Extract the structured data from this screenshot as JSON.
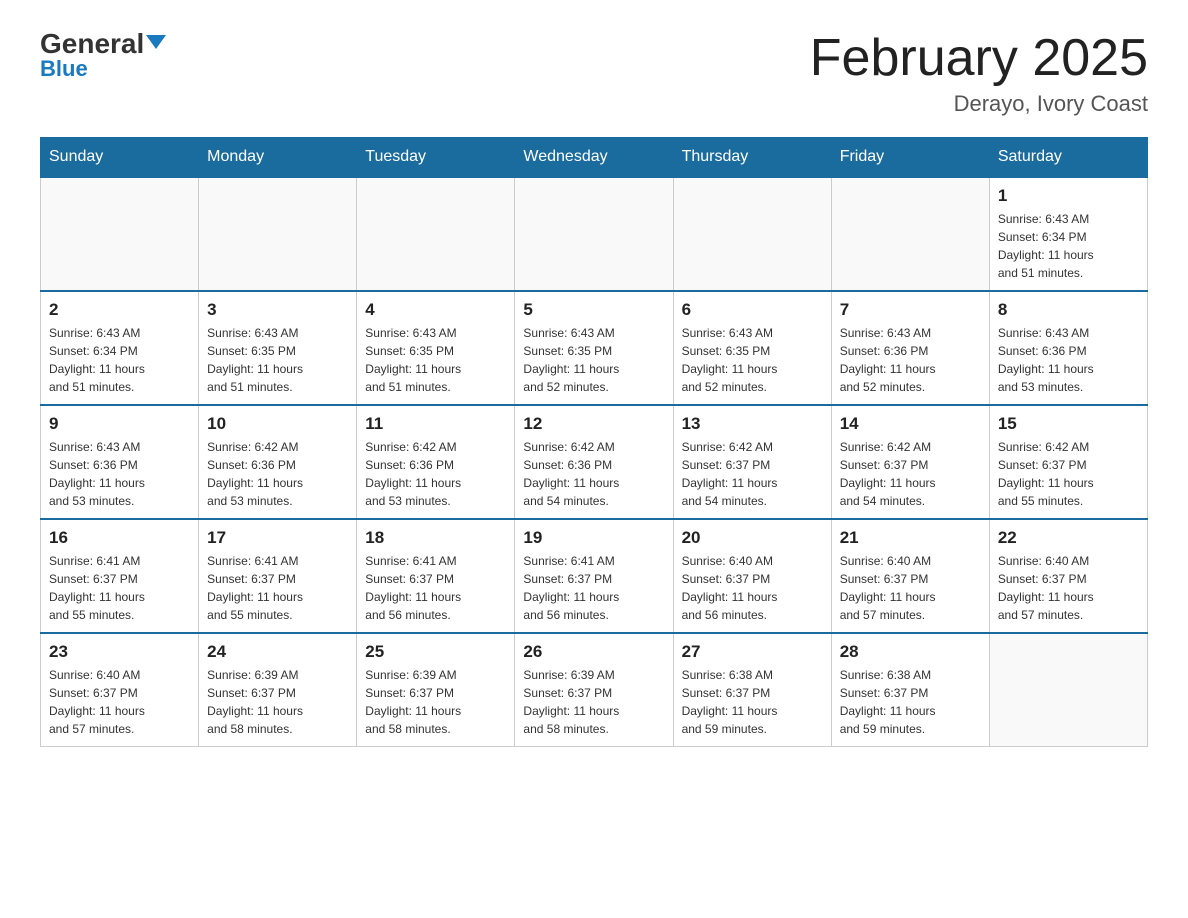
{
  "header": {
    "logo_general": "General",
    "logo_blue": "Blue",
    "title": "February 2025",
    "subtitle": "Derayo, Ivory Coast"
  },
  "days_of_week": [
    "Sunday",
    "Monday",
    "Tuesday",
    "Wednesday",
    "Thursday",
    "Friday",
    "Saturday"
  ],
  "weeks": [
    {
      "days": [
        {
          "number": "",
          "info": ""
        },
        {
          "number": "",
          "info": ""
        },
        {
          "number": "",
          "info": ""
        },
        {
          "number": "",
          "info": ""
        },
        {
          "number": "",
          "info": ""
        },
        {
          "number": "",
          "info": ""
        },
        {
          "number": "1",
          "info": "Sunrise: 6:43 AM\nSunset: 6:34 PM\nDaylight: 11 hours\nand 51 minutes."
        }
      ]
    },
    {
      "days": [
        {
          "number": "2",
          "info": "Sunrise: 6:43 AM\nSunset: 6:34 PM\nDaylight: 11 hours\nand 51 minutes."
        },
        {
          "number": "3",
          "info": "Sunrise: 6:43 AM\nSunset: 6:35 PM\nDaylight: 11 hours\nand 51 minutes."
        },
        {
          "number": "4",
          "info": "Sunrise: 6:43 AM\nSunset: 6:35 PM\nDaylight: 11 hours\nand 51 minutes."
        },
        {
          "number": "5",
          "info": "Sunrise: 6:43 AM\nSunset: 6:35 PM\nDaylight: 11 hours\nand 52 minutes."
        },
        {
          "number": "6",
          "info": "Sunrise: 6:43 AM\nSunset: 6:35 PM\nDaylight: 11 hours\nand 52 minutes."
        },
        {
          "number": "7",
          "info": "Sunrise: 6:43 AM\nSunset: 6:36 PM\nDaylight: 11 hours\nand 52 minutes."
        },
        {
          "number": "8",
          "info": "Sunrise: 6:43 AM\nSunset: 6:36 PM\nDaylight: 11 hours\nand 53 minutes."
        }
      ]
    },
    {
      "days": [
        {
          "number": "9",
          "info": "Sunrise: 6:43 AM\nSunset: 6:36 PM\nDaylight: 11 hours\nand 53 minutes."
        },
        {
          "number": "10",
          "info": "Sunrise: 6:42 AM\nSunset: 6:36 PM\nDaylight: 11 hours\nand 53 minutes."
        },
        {
          "number": "11",
          "info": "Sunrise: 6:42 AM\nSunset: 6:36 PM\nDaylight: 11 hours\nand 53 minutes."
        },
        {
          "number": "12",
          "info": "Sunrise: 6:42 AM\nSunset: 6:36 PM\nDaylight: 11 hours\nand 54 minutes."
        },
        {
          "number": "13",
          "info": "Sunrise: 6:42 AM\nSunset: 6:37 PM\nDaylight: 11 hours\nand 54 minutes."
        },
        {
          "number": "14",
          "info": "Sunrise: 6:42 AM\nSunset: 6:37 PM\nDaylight: 11 hours\nand 54 minutes."
        },
        {
          "number": "15",
          "info": "Sunrise: 6:42 AM\nSunset: 6:37 PM\nDaylight: 11 hours\nand 55 minutes."
        }
      ]
    },
    {
      "days": [
        {
          "number": "16",
          "info": "Sunrise: 6:41 AM\nSunset: 6:37 PM\nDaylight: 11 hours\nand 55 minutes."
        },
        {
          "number": "17",
          "info": "Sunrise: 6:41 AM\nSunset: 6:37 PM\nDaylight: 11 hours\nand 55 minutes."
        },
        {
          "number": "18",
          "info": "Sunrise: 6:41 AM\nSunset: 6:37 PM\nDaylight: 11 hours\nand 56 minutes."
        },
        {
          "number": "19",
          "info": "Sunrise: 6:41 AM\nSunset: 6:37 PM\nDaylight: 11 hours\nand 56 minutes."
        },
        {
          "number": "20",
          "info": "Sunrise: 6:40 AM\nSunset: 6:37 PM\nDaylight: 11 hours\nand 56 minutes."
        },
        {
          "number": "21",
          "info": "Sunrise: 6:40 AM\nSunset: 6:37 PM\nDaylight: 11 hours\nand 57 minutes."
        },
        {
          "number": "22",
          "info": "Sunrise: 6:40 AM\nSunset: 6:37 PM\nDaylight: 11 hours\nand 57 minutes."
        }
      ]
    },
    {
      "days": [
        {
          "number": "23",
          "info": "Sunrise: 6:40 AM\nSunset: 6:37 PM\nDaylight: 11 hours\nand 57 minutes."
        },
        {
          "number": "24",
          "info": "Sunrise: 6:39 AM\nSunset: 6:37 PM\nDaylight: 11 hours\nand 58 minutes."
        },
        {
          "number": "25",
          "info": "Sunrise: 6:39 AM\nSunset: 6:37 PM\nDaylight: 11 hours\nand 58 minutes."
        },
        {
          "number": "26",
          "info": "Sunrise: 6:39 AM\nSunset: 6:37 PM\nDaylight: 11 hours\nand 58 minutes."
        },
        {
          "number": "27",
          "info": "Sunrise: 6:38 AM\nSunset: 6:37 PM\nDaylight: 11 hours\nand 59 minutes."
        },
        {
          "number": "28",
          "info": "Sunrise: 6:38 AM\nSunset: 6:37 PM\nDaylight: 11 hours\nand 59 minutes."
        },
        {
          "number": "",
          "info": ""
        }
      ]
    }
  ]
}
